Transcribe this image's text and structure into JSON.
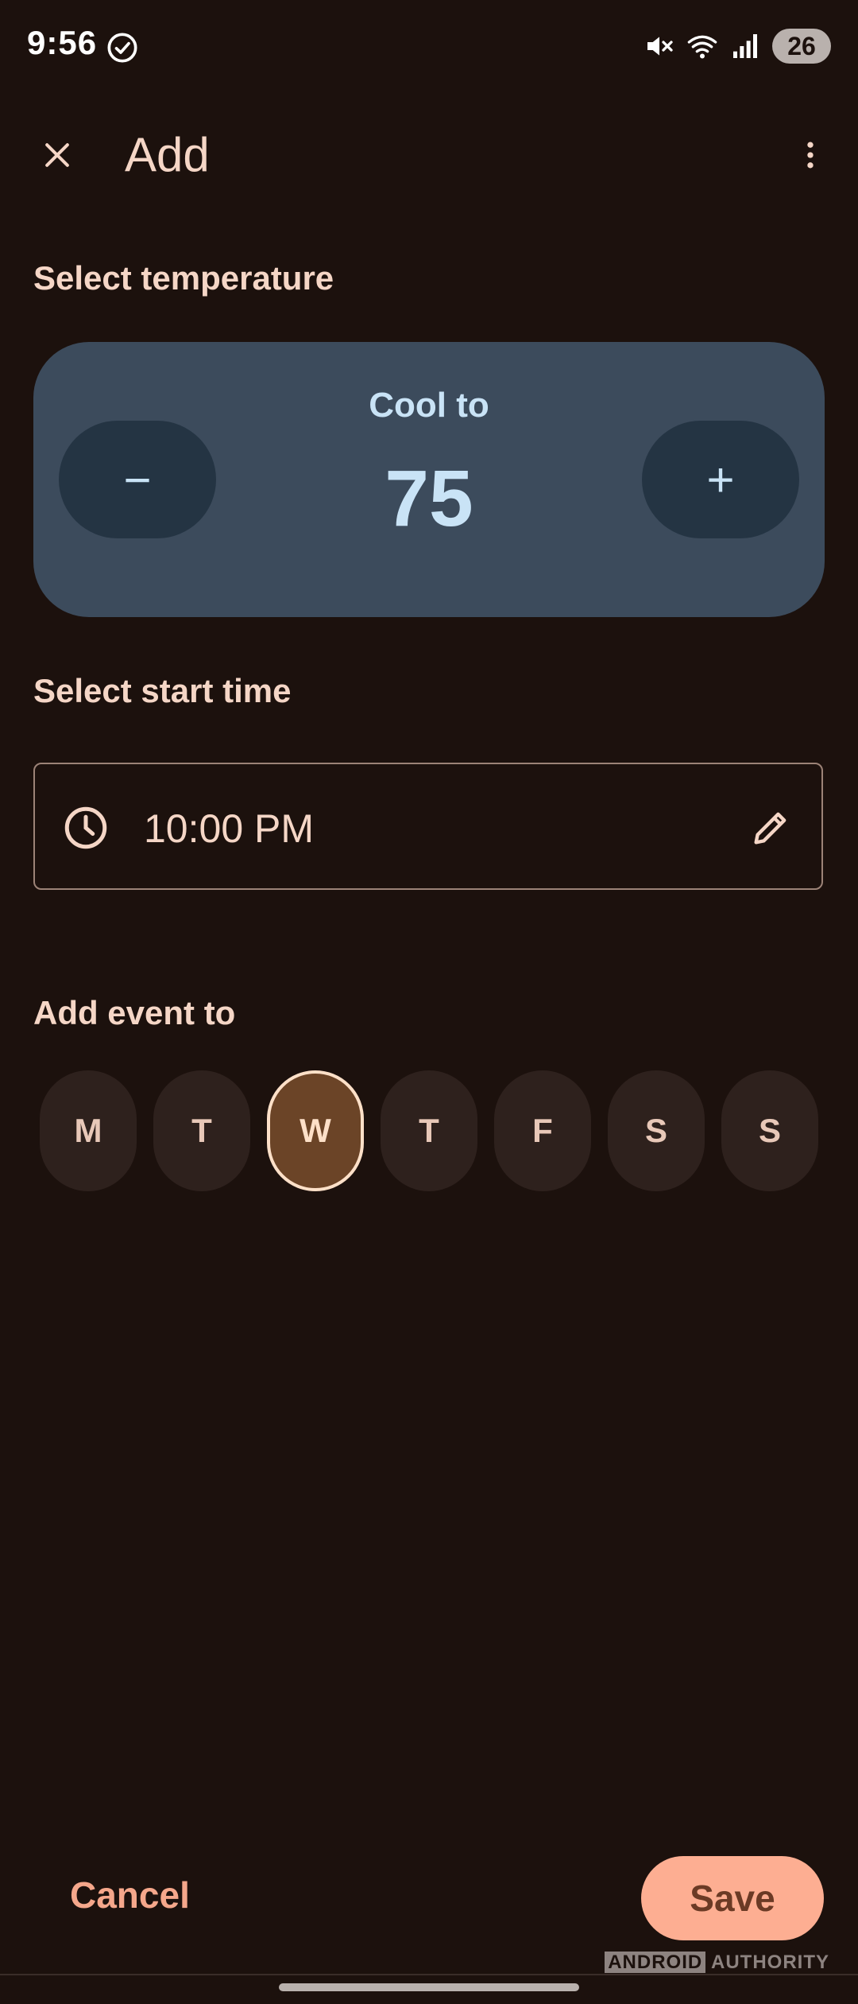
{
  "status_bar": {
    "time": "9:56",
    "battery": "26",
    "icons": [
      "check-circle-icon",
      "mute-icon",
      "wifi-icon",
      "signal-icon"
    ]
  },
  "app_bar": {
    "title": "Add",
    "close_icon": "close-icon",
    "more_icon": "more-vert-icon"
  },
  "temperature": {
    "section_label": "Select temperature",
    "mode_label": "Cool to",
    "value": "75",
    "decrease_label": "−",
    "increase_label": "+"
  },
  "start_time": {
    "section_label": "Select start time",
    "value": "10:00 PM",
    "leading_icon": "clock-icon",
    "trailing_icon": "edit-pencil-icon"
  },
  "event_days": {
    "section_label": "Add event to",
    "days": [
      {
        "label": "M",
        "selected": false
      },
      {
        "label": "T",
        "selected": false
      },
      {
        "label": "W",
        "selected": true
      },
      {
        "label": "T",
        "selected": false
      },
      {
        "label": "F",
        "selected": false
      },
      {
        "label": "S",
        "selected": false
      },
      {
        "label": "S",
        "selected": false
      }
    ]
  },
  "actions": {
    "cancel_label": "Cancel",
    "save_label": "Save"
  },
  "watermark": {
    "part1": "ANDROID",
    "part2": "AUTHORITY"
  },
  "colors": {
    "background": "#1c110d",
    "card": "#3c4b5c",
    "card_button": "#243443",
    "accent_text": "#c9e3f6",
    "primary": "#fdae92",
    "selected_day": "#6b4427"
  }
}
